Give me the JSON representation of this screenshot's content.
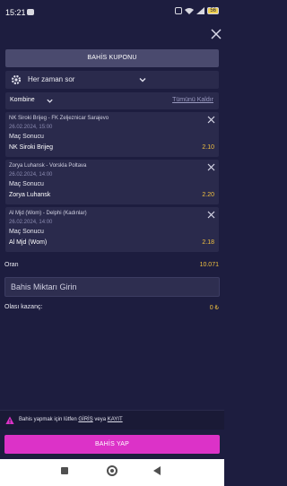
{
  "status_bar": {
    "time": "15:21",
    "battery": "56"
  },
  "coupon": {
    "title": "BAHİS KUPONU",
    "odds_setting": "Her zaman sor",
    "bet_type": "Kombine",
    "clear_all": "Tümünü Kaldır"
  },
  "bets": [
    {
      "match": "NK Siroki Brijeg - FK Zeljeznicar Sarajevo",
      "date": "26.02.2024, 15:00",
      "market": "Maç Sonucu",
      "pick": "NK Siroki Brijeg",
      "odds": "2.10"
    },
    {
      "match": "Zorya Luhansk - Vorskla Poltava",
      "date": "26.02.2024, 14:00",
      "market": "Maç Sonucu",
      "pick": "Zorya Luhansk",
      "odds": "2.20"
    },
    {
      "match": "Al Mjd (Wom) - Delphi (Kadınlar)",
      "date": "26.02.2024, 14:00",
      "market": "Maç Sonucu",
      "pick": "Al Mjd (Wom)",
      "odds": "2.18"
    }
  ],
  "summary": {
    "odds_label": "Oran",
    "odds_value": "10.071",
    "stake_placeholder": "Bahis Miktarı Girin",
    "win_label": "Olası kazanç:",
    "win_value": "0 ₺"
  },
  "login_prompt": {
    "prefix": "Bahis yapmak için lütfen",
    "login": "GİRİŞ",
    "or": "veya",
    "register": "KAYIT"
  },
  "place_bet_label": "BAHİS YAP",
  "colors": {
    "background": "#1d1d3f",
    "panel": "#2a2a4c",
    "accent": "#dc32c8",
    "odds": "#f0c040"
  }
}
